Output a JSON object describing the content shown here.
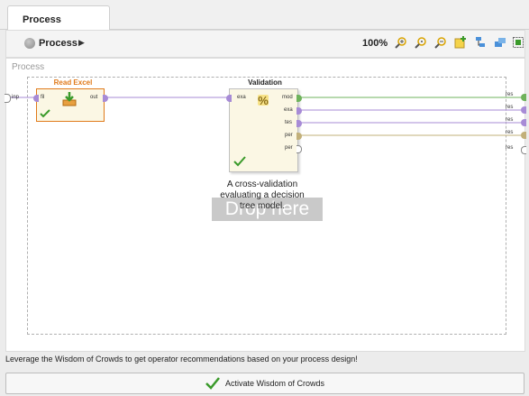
{
  "tab": {
    "label": "Process"
  },
  "toolbar": {
    "process_label": "Process",
    "arrow": "▶",
    "zoom": "100%"
  },
  "canvas": {
    "title": "Process",
    "input_port": "inp",
    "output_ports": [
      "res",
      "res",
      "res",
      "res",
      "res"
    ]
  },
  "read_excel": {
    "title": "Read Excel",
    "in_port": "fil",
    "out_port": "out"
  },
  "validation": {
    "title": "Validation",
    "in_port": "exa",
    "out_ports": [
      "mod",
      "exa",
      "tes",
      "per",
      "per"
    ]
  },
  "annotation": {
    "text": "A cross-validation evaluating a decision tree model."
  },
  "watermark": "Drop here",
  "hint": "Leverage the Wisdom of Crowds to get operator recommendations based on your process design!",
  "activate_button": {
    "label": "Activate Wisdom of Crowds"
  },
  "colors": {
    "read_excel_title": "#e07a1a",
    "port_purple": "#a78bd6",
    "port_olive": "#c2b07a",
    "check_green": "#3a9a2a",
    "line_green": "#6fb35c"
  }
}
